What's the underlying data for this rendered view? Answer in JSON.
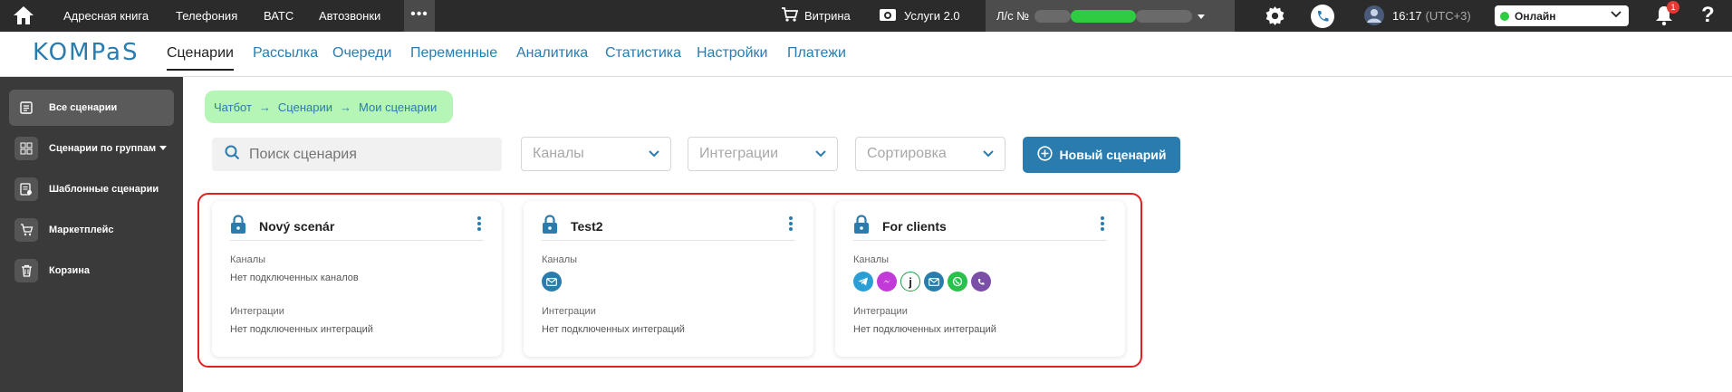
{
  "topbar": {
    "nav": [
      "Адресная книга",
      "Телефония",
      "ВАТС",
      "Автозвонки"
    ],
    "more": "•••",
    "vitrina": "Витрина",
    "services": "Услуги 2.0",
    "account_label": "Л/с №",
    "time": "16:17",
    "timezone": "(UTC+3)",
    "status": "Онлайн",
    "notifications_count": "1"
  },
  "brand": {
    "logo": "KOMPaS",
    "tabs": [
      "Сценарии",
      "Рассылка",
      "Очереди",
      "Переменные",
      "Аналитика",
      "Статистика",
      "Настройки",
      "Платежи"
    ],
    "active_tab": "Сценарии"
  },
  "sidebar": {
    "items": [
      {
        "label": "Все сценарии",
        "icon": "list-icon"
      },
      {
        "label": "Сценарии по группам",
        "icon": "grid-icon"
      },
      {
        "label": "Шаблонные сценарии",
        "icon": "template-icon"
      },
      {
        "label": "Маркетплейс",
        "icon": "cart-icon"
      },
      {
        "label": "Корзина",
        "icon": "trash-icon"
      }
    ]
  },
  "breadcrumb": [
    "Чатбот",
    "Сценарии",
    "Мои сценарии"
  ],
  "filters": {
    "search_placeholder": "Поиск сценария",
    "channels": "Каналы",
    "integrations": "Интеграции",
    "sort": "Сортировка",
    "new_button": "Новый сценарий"
  },
  "cards": [
    {
      "title": "Nový scenár",
      "channels_label": "Каналы",
      "channels_value": "Нет подключенных каналов",
      "integrations_label": "Интеграции",
      "integrations_value": "Нет подключенных интеграций"
    },
    {
      "title": "Test2",
      "channels_label": "Каналы",
      "channels_value": "",
      "integrations_label": "Интеграции",
      "integrations_value": "Нет подключенных интеграций"
    },
    {
      "title": "For clients",
      "channels_label": "Каналы",
      "channels_value": "",
      "integrations_label": "Интеграции",
      "integrations_value": "Нет подключенных интеграций"
    }
  ],
  "colors": {
    "accent": "#2a7cae",
    "breadcrumb_bg": "#b5f5b5",
    "highlight": "#e02020"
  }
}
